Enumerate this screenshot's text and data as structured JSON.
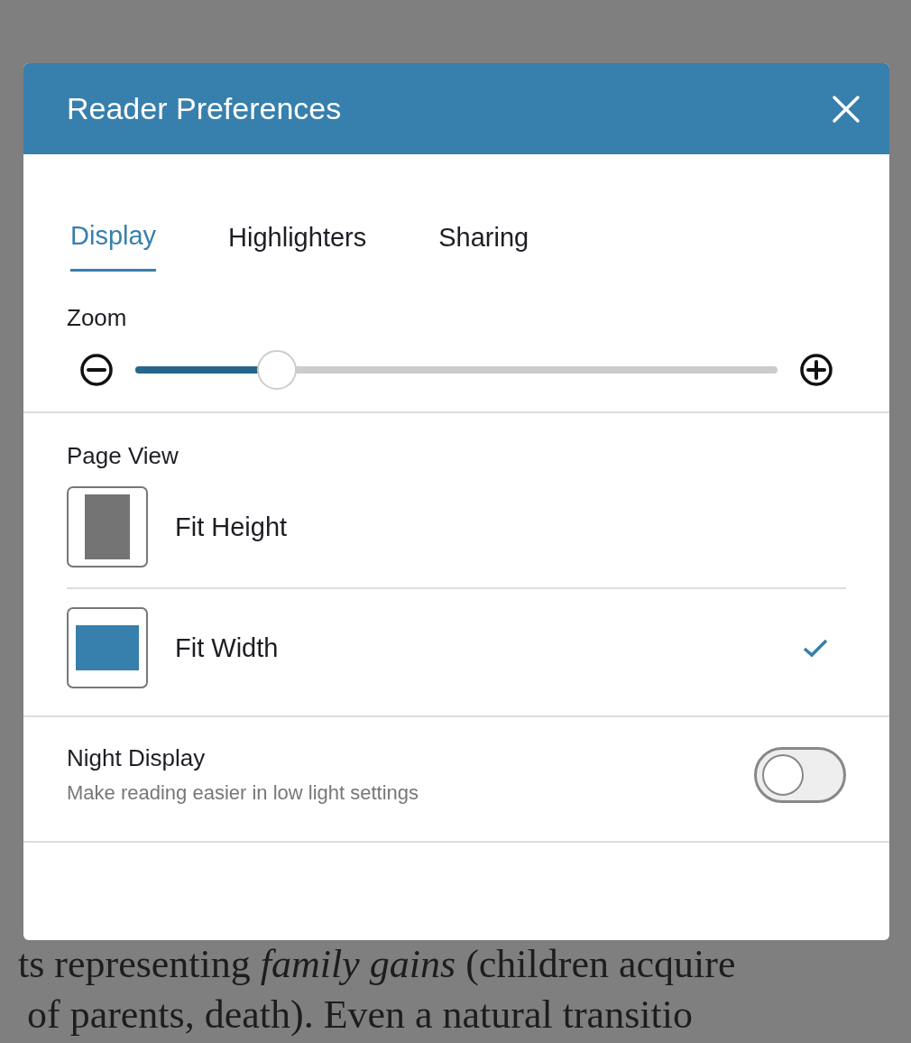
{
  "page_text": {
    "full_lines": [
      "ts representing *family gains* (children acquire",
      "of parents, death). Even a natural transitio"
    ]
  },
  "dialog": {
    "title": "Reader Preferences",
    "tabs": [
      {
        "label": "Display",
        "selected": true
      },
      {
        "label": "Highlighters",
        "selected": false
      },
      {
        "label": "Sharing",
        "selected": false
      }
    ],
    "zoom": {
      "label": "Zoom",
      "level": 0.22
    },
    "page_view": {
      "label": "Page View",
      "options": [
        {
          "kind": "height",
          "label": "Fit Height",
          "selected": false
        },
        {
          "kind": "width",
          "label": "Fit Width",
          "selected": true
        }
      ]
    },
    "night_display": {
      "title": "Night Display",
      "description": "Make reading easier in low light settings",
      "on": false
    }
  }
}
